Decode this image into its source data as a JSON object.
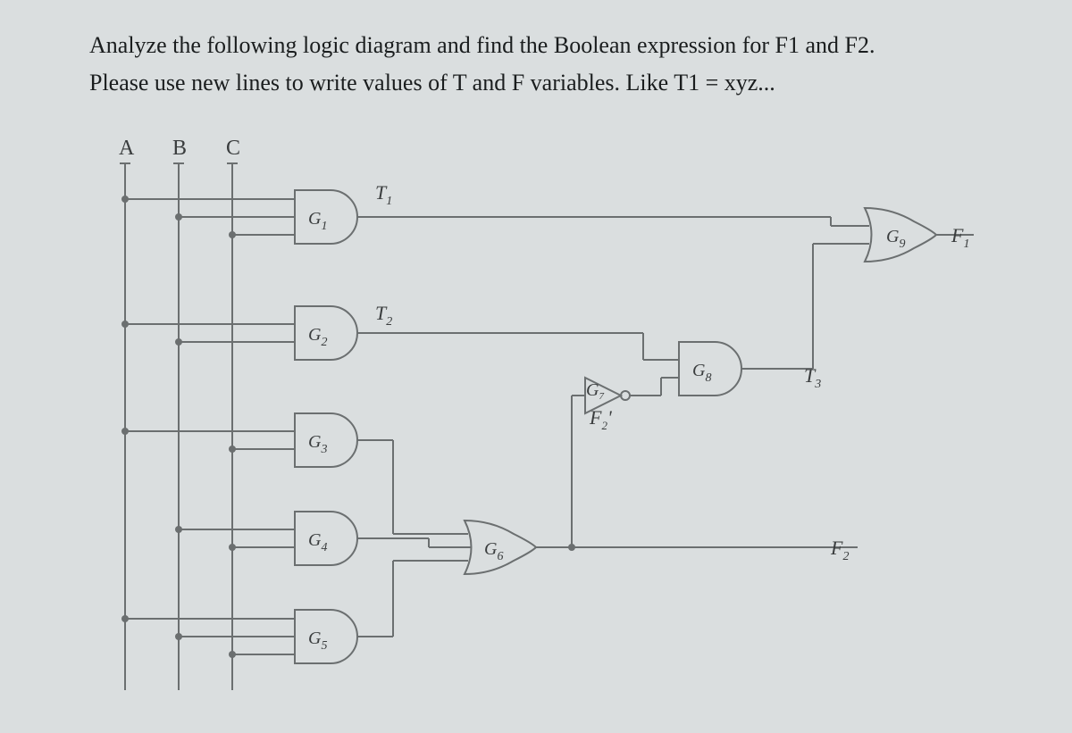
{
  "question_line1": "Analyze the following logic diagram and find the Boolean expression for F1 and F2.",
  "question_line2": "Please use new lines to write values of T and F variables. Like T1 = xyz...",
  "inputs": {
    "A": "A",
    "B": "B",
    "C": "C"
  },
  "gates": {
    "G1": "G",
    "G1s": "1",
    "G2": "G",
    "G2s": "2",
    "G3": "G",
    "G3s": "3",
    "G4": "G",
    "G4s": "4",
    "G5": "G",
    "G5s": "5",
    "G6": "G",
    "G6s": "6",
    "G7": "G",
    "G7s": "7",
    "G8": "G",
    "G8s": "8",
    "G9": "G",
    "G9s": "9"
  },
  "signals": {
    "T1": "T",
    "T1s": "1",
    "T2": "T",
    "T2s": "2",
    "T3": "T",
    "T3s": "3",
    "F2p": "F",
    "F2ps": "2",
    "F2pa": "'"
  },
  "outputs": {
    "F1": "F",
    "F1s": "1",
    "F2": "F",
    "F2s": "2"
  },
  "chart_data": {
    "type": "logic-diagram",
    "inputs": [
      "A",
      "B",
      "C"
    ],
    "gates": [
      {
        "id": "G1",
        "type": "AND",
        "inputs": [
          "A",
          "B",
          "C"
        ],
        "output": "T1"
      },
      {
        "id": "G2",
        "type": "AND",
        "inputs": [
          "A",
          "B"
        ],
        "output": "T2"
      },
      {
        "id": "G3",
        "type": "AND",
        "inputs": [
          "A",
          "C"
        ],
        "output": "G3_out"
      },
      {
        "id": "G4",
        "type": "AND",
        "inputs": [
          "B",
          "C"
        ],
        "output": "G4_out"
      },
      {
        "id": "G5",
        "type": "AND",
        "inputs": [
          "A",
          "B",
          "C"
        ],
        "output": "G5_out"
      },
      {
        "id": "G6",
        "type": "OR",
        "inputs": [
          "G3_out",
          "G4_out",
          "G5_out"
        ],
        "output": "F2"
      },
      {
        "id": "G7",
        "type": "NOT",
        "inputs": [
          "F2"
        ],
        "output": "F2'"
      },
      {
        "id": "G8",
        "type": "AND",
        "inputs": [
          "T2",
          "F2'"
        ],
        "output": "T3"
      },
      {
        "id": "G9",
        "type": "OR",
        "inputs": [
          "T1",
          "T3"
        ],
        "output": "F1"
      }
    ],
    "outputs": [
      "F1",
      "F2"
    ]
  }
}
